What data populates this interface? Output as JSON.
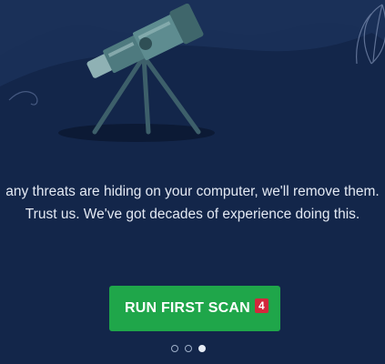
{
  "message": {
    "line1": "any threats are hiding on your computer, we'll remove them.",
    "line2": "Trust us. We've got decades of experience doing this."
  },
  "scan_button": {
    "label": "RUN FIRST SCAN",
    "badge": "4"
  },
  "pager": {
    "total": 3,
    "active_index": 2
  },
  "colors": {
    "background": "#13264a",
    "button": "#1fa64a",
    "badge": "#d3283c"
  },
  "illustration": {
    "icons": [
      "telescope-icon",
      "leaf-decoration-icon"
    ]
  }
}
